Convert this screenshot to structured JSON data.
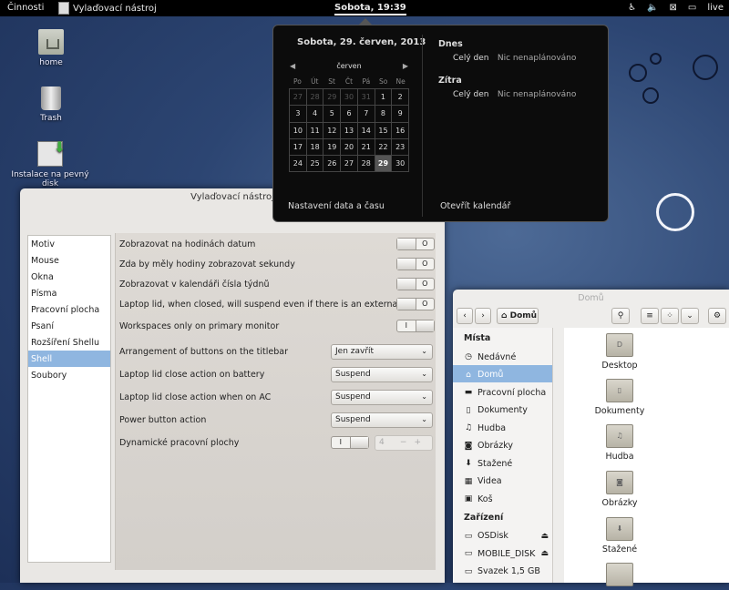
{
  "topbar": {
    "activities": "Činnosti",
    "app_name": "Vylaďovací nástroj",
    "clock": "Sobota, 19:39",
    "user": "live"
  },
  "desktop": {
    "icons": [
      {
        "label": "home"
      },
      {
        "label": "Trash"
      },
      {
        "label": "Instalace na pevný disk"
      }
    ]
  },
  "tweak": {
    "title": "Vylaďovací nástroj",
    "categories": [
      "Motiv",
      "Mouse",
      "Okna",
      "Písma",
      "Pracovní plocha",
      "Psaní",
      "Rozšíření Shellu",
      "Shell",
      "Soubory"
    ],
    "selected_category": "Shell",
    "settings": [
      {
        "label": "Zobrazovat na hodinách datum",
        "state": "off"
      },
      {
        "label": "Zda by měly hodiny zobrazovat sekundy",
        "state": "off"
      },
      {
        "label": "Zobrazovat v kalendáři čísla týdnů",
        "state": "off"
      },
      {
        "label": "Laptop lid, when closed, will suspend even if there is an external monit...",
        "state": "off"
      },
      {
        "label": "Workspaces only on primary monitor",
        "state": "on"
      },
      {
        "label": "Arrangement of buttons on the titlebar",
        "value": "Jen zavřít"
      },
      {
        "label": "Laptop lid close action on battery",
        "value": "Suspend"
      },
      {
        "label": "Laptop lid close action when on AC",
        "value": "Suspend"
      },
      {
        "label": "Power button action",
        "value": "Suspend"
      },
      {
        "label": "Dynamické pracovní plochy",
        "state": "on",
        "spin_value": "4"
      }
    ],
    "switch_on_label": "I",
    "switch_off_label": "O"
  },
  "files": {
    "title": "Domů",
    "location": "Domů",
    "places_header": "Místa",
    "places": [
      "Nedávné",
      "Domů",
      "Pracovní plocha",
      "Dokumenty",
      "Hudba",
      "Obrázky",
      "Stažené",
      "Videa",
      "Koš"
    ],
    "devices_header": "Zařízení",
    "devices": [
      "OSDisk",
      "MOBILE_DISK",
      "Svazek 1,5 GB"
    ],
    "folders": [
      "Desktop",
      "Dokumenty",
      "Hudba",
      "Obrázky",
      "Stažené"
    ]
  },
  "calendar": {
    "date": "Sobota, 29. červen, 2013",
    "month": "červen",
    "weekdays": [
      "Po",
      "Út",
      "St",
      "Čt",
      "Pá",
      "So",
      "Ne"
    ],
    "weeks": [
      [
        "27",
        "28",
        "29",
        "30",
        "31",
        "1",
        "2"
      ],
      [
        "3",
        "4",
        "5",
        "6",
        "7",
        "8",
        "9"
      ],
      [
        "10",
        "11",
        "12",
        "13",
        "14",
        "15",
        "16"
      ],
      [
        "17",
        "18",
        "19",
        "20",
        "21",
        "22",
        "23"
      ],
      [
        "24",
        "25",
        "26",
        "27",
        "28",
        "29",
        "30"
      ]
    ],
    "today": "29",
    "today_label": "Dnes",
    "tomorrow_label": "Zítra",
    "all_day": "Celý den",
    "nothing": "Nic nenaplánováno",
    "settings_link": "Nastavení data a času",
    "open_link": "Otevřít kalendář"
  }
}
